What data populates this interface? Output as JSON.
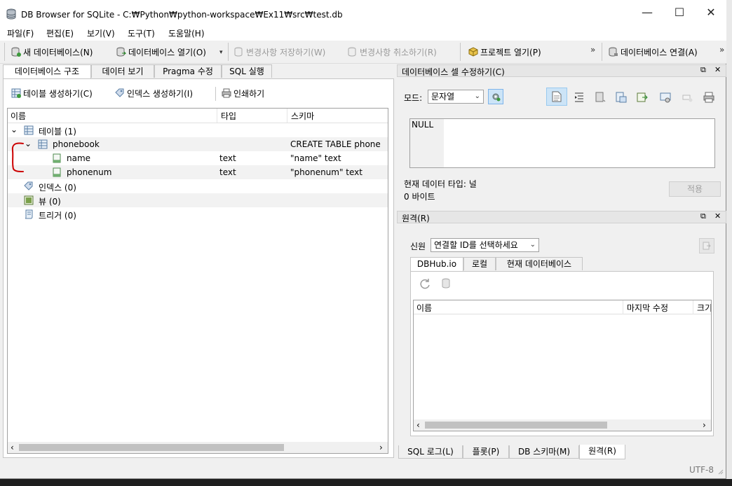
{
  "window": {
    "title": "DB Browser for SQLite - C:₩Python₩python-workspace₩Ex11₩src₩test.db",
    "minimize": "—",
    "maximize": "☐",
    "close": "✕"
  },
  "menu": [
    "파일(F)",
    "편집(E)",
    "보기(V)",
    "도구(T)",
    "도움말(H)"
  ],
  "toolbar": {
    "new_db": "새 데이터베이스(N)",
    "open_db": "데이터베이스 열기(O)",
    "write_changes": "변경사항 저장하기(W)",
    "revert_changes": "변경사항 취소하기(R)",
    "open_project": "프로젝트 열기(P)",
    "attach_db": "데이터베이스 연결(A)",
    "overflow": "»"
  },
  "left_tabs": [
    "데이터베이스 구조",
    "데이터 보기",
    "Pragma 수정",
    "SQL 실행"
  ],
  "structure_toolbar": {
    "create_table": "테이블 생성하기(C)",
    "create_index": "인덱스 생성하기(I)",
    "print": "인쇄하기"
  },
  "tree": {
    "headers": [
      "이름",
      "타입",
      "스키마"
    ],
    "rows": [
      {
        "name": "테이블 (1)",
        "type": "",
        "schema": "",
        "icon": "table-group-icon",
        "expander": "⌄"
      },
      {
        "name": "phonebook",
        "type": "",
        "schema": "CREATE TABLE phone",
        "icon": "table-icon",
        "expander": "⌄"
      },
      {
        "name": "name",
        "type": "text",
        "schema": "\"name\" text",
        "icon": "field-icon",
        "expander": ""
      },
      {
        "name": "phonenum",
        "type": "text",
        "schema": "\"phonenum\" text",
        "icon": "field-icon",
        "expander": ""
      },
      {
        "name": "인덱스 (0)",
        "type": "",
        "schema": "",
        "icon": "index-icon",
        "expander": ""
      },
      {
        "name": "뷰 (0)",
        "type": "",
        "schema": "",
        "icon": "view-icon",
        "expander": ""
      },
      {
        "name": "트리거 (0)",
        "type": "",
        "schema": "",
        "icon": "trigger-icon",
        "expander": ""
      }
    ],
    "scroll_left": "‹",
    "scroll_right": "›"
  },
  "edit_cell": {
    "title": "데이터베이스 셀 수정하기(C)",
    "mode_label": "모드:",
    "mode_value": "문자열",
    "cell_value": "NULL",
    "type_label": "현재 데이터 타입: 널",
    "size_label": "0 바이트",
    "apply": "적용"
  },
  "remote": {
    "title": "원격(R)",
    "identity_label": "신원",
    "identity_value": "연결할 ID를 선택하세요",
    "tabs": [
      "DBHub.io",
      "로컬",
      "현재 데이터베이스"
    ],
    "headers": [
      "이름",
      "마지막 수정",
      "크기"
    ],
    "scroll_left": "‹",
    "scroll_right": "›"
  },
  "bottom_tabs": [
    "SQL 로그(L)",
    "플롯(P)",
    "DB 스키마(M)",
    "원격(R)"
  ],
  "status": {
    "encoding": "UTF-8"
  },
  "dock_controls": {
    "float": "⧉",
    "close": "✕"
  },
  "colors": {
    "annotation": "#cc0000",
    "accent": "#cce4f7"
  }
}
